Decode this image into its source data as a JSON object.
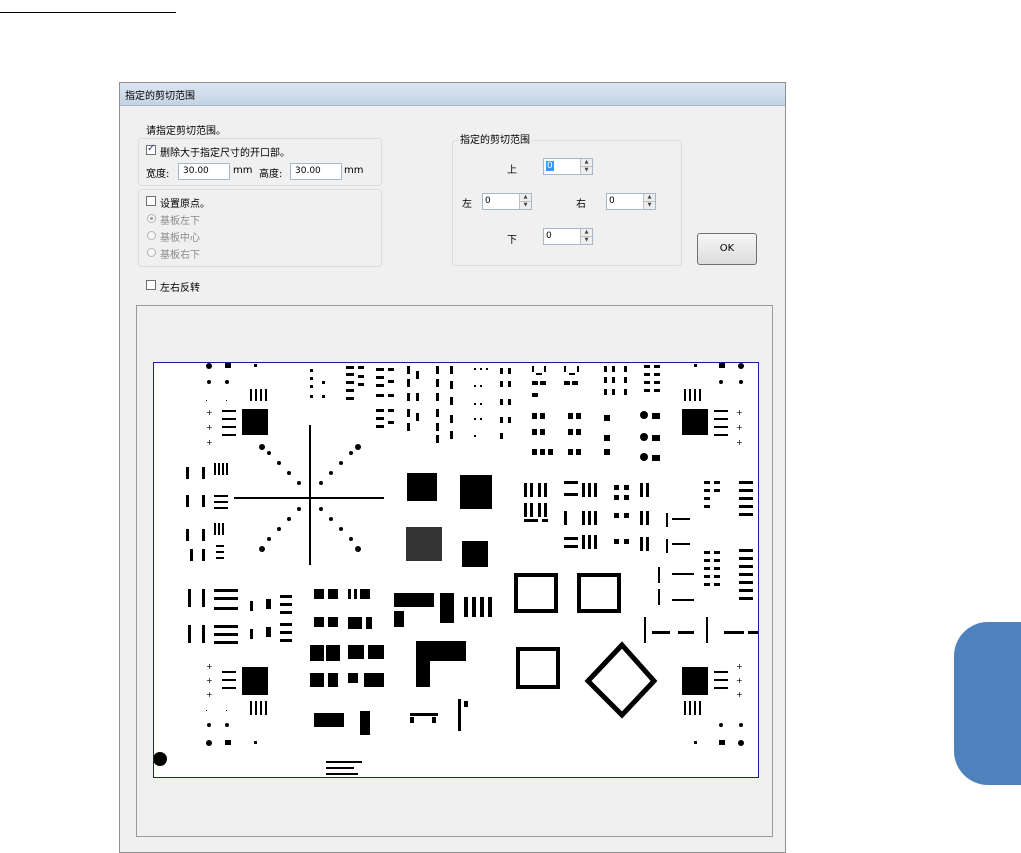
{
  "dialog": {
    "title": "指定的剪切范围",
    "instruction": "请指定剪切范围。",
    "remove_oversize_label": "删除大于指定尺寸的开口部。",
    "remove_oversize_checked": true,
    "width_label": "宽度:",
    "width_value": "30.00",
    "width_unit": "mm",
    "height_label": "高度:",
    "height_value": "30.00",
    "height_unit": "mm",
    "set_origin_label": "设置原点。",
    "set_origin_checked": false,
    "origin_options": [
      "基板左下",
      "基板中心",
      "基板右下"
    ],
    "origin_selected": "基板左下",
    "range_group_title": "指定的剪切范围",
    "top_label": "上",
    "top_value": "0",
    "left_label": "左",
    "left_value": "0",
    "right_label": "右",
    "right_value": "0",
    "bottom_label": "下",
    "bottom_value": "0",
    "ok_label": "OK",
    "mirror_label": "左右反转",
    "mirror_checked": false
  },
  "colors": {
    "side_tab": "#4f81bd",
    "board_border": "#1a1aa0",
    "dialog_bg": "#f0f0f0"
  }
}
